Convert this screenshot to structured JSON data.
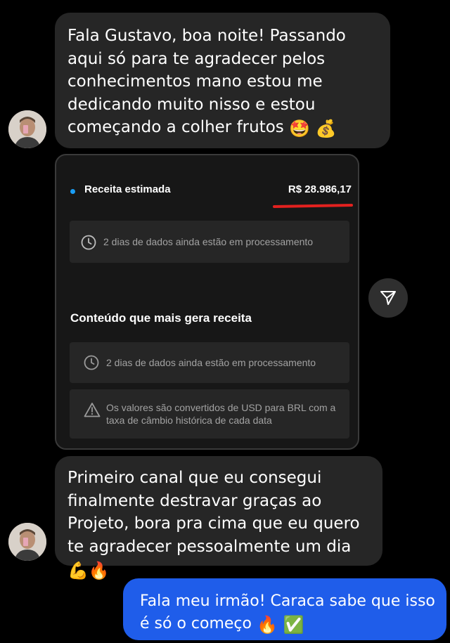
{
  "messages": [
    {
      "text": "Fala Gustavo, boa noite! Passando aqui só para te agradecer pelos conhecimentos mano estou me dedicando muito nisso e estou começando a colher frutos",
      "emoji": "🤩 💰"
    },
    {
      "text": "Primeiro canal que eu consegui finalmente destravar graças ao Projeto, bora pra cima que eu quero te agradecer pessoalmente um dia",
      "emoji": "💪🔥"
    },
    {
      "text": "Fala meu irmão! Caraca sabe que isso é só o começo",
      "emoji": "🔥 ✅"
    }
  ],
  "card": {
    "revenue_label": "Receita estimada",
    "revenue_value": "R$ 28.986,17",
    "processing_note": "2 dias de dados ainda estão em processamento",
    "section_title": "Conteúdo que mais gera receita",
    "processing_note_2": "2 dias de dados ainda estão em processamento",
    "conversion_note": "Os valores são convertidos de USD para BRL com a taxa de câmbio histórica de cada data"
  },
  "colors": {
    "incoming_bubble": "#262626",
    "outgoing_bubble": "#1f5dea",
    "accent_dot": "#1a9ef5",
    "underline": "#e3211f"
  },
  "icons": [
    "clock-icon",
    "warning-icon",
    "share-icon"
  ]
}
